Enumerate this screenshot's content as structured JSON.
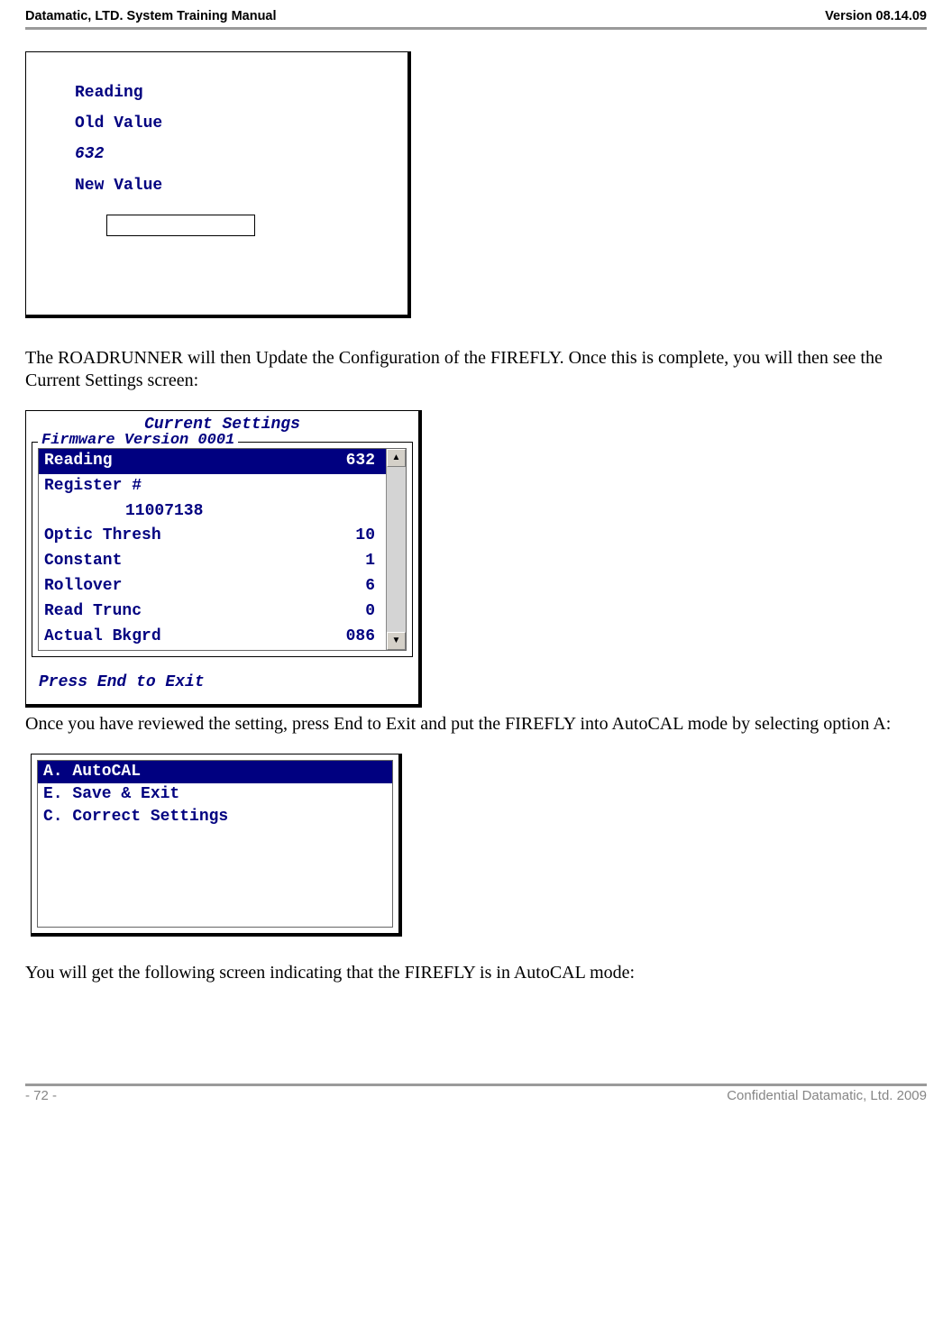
{
  "header": {
    "left": "Datamatic, LTD. System Training  Manual",
    "right": "Version 08.14.09"
  },
  "win1": {
    "line_reading": "Reading",
    "line_old": "Old Value",
    "line_632": "632",
    "line_new": "New Value",
    "input_value": ""
  },
  "para1": "The ROADRUNNER will then Update the Configuration of the FIREFLY. Once this is complete, you will then see the Current Settings screen:",
  "win2": {
    "title": "Current Settings",
    "legend": "Firmware Version 0001",
    "rows": [
      {
        "label": "Reading",
        "value": "632",
        "selected": true
      },
      {
        "label": "Register #",
        "value": "",
        "selected": false
      },
      {
        "label_indented": "11007138",
        "selected": false
      },
      {
        "label": "Optic Thresh",
        "value": "10",
        "selected": false
      },
      {
        "label": "Constant",
        "value": "1",
        "selected": false
      },
      {
        "label": "Rollover",
        "value": "6",
        "selected": false
      },
      {
        "label": "Read Trunc",
        "value": "0",
        "selected": false
      },
      {
        "label": "Actual Bkgrd",
        "value": "086",
        "selected": false
      }
    ],
    "footer": "Press End to Exit"
  },
  "para2": "Once you have reviewed the setting, press End to Exit and put the FIREFLY into AutoCAL mode by selecting option A:",
  "win3": {
    "items": [
      {
        "label": "A. AutoCAL",
        "selected": true
      },
      {
        "label": "E. Save & Exit",
        "selected": false
      },
      {
        "label": "C. Correct Settings",
        "selected": false
      }
    ]
  },
  "para3": "You will get the following screen indicating that the FIREFLY is in AutoCAL mode:",
  "footer": {
    "left": "- 72 -",
    "right": "Confidential Datamatic, Ltd. 2009"
  },
  "scroll_arrows": {
    "up": "▲",
    "down": "▼"
  }
}
